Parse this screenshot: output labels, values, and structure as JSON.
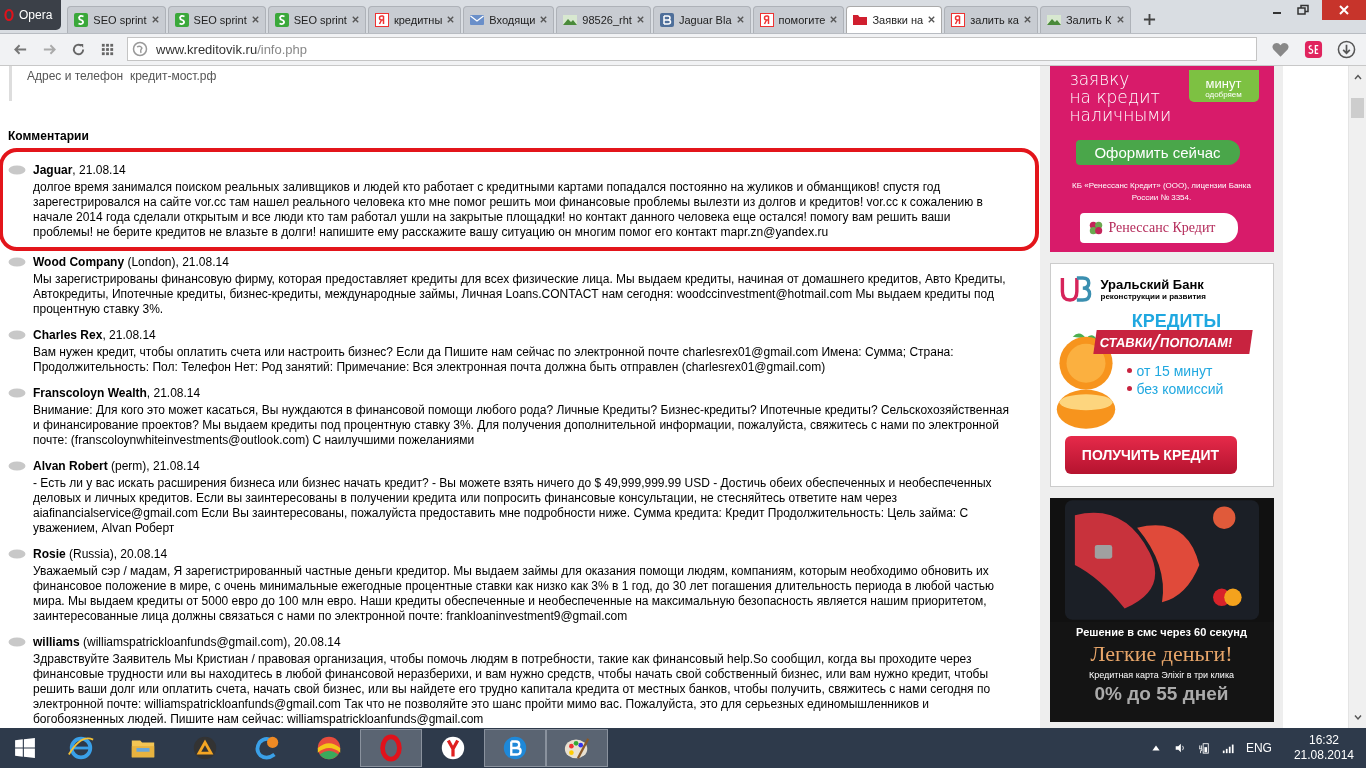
{
  "browser": {
    "menu_label": "Opera"
  },
  "tabs": [
    {
      "title": "SEO sprint",
      "kind": "seo",
      "selected": false
    },
    {
      "title": "SEO sprint",
      "kind": "seo",
      "selected": false
    },
    {
      "title": "SEO sprint",
      "kind": "seo",
      "selected": false
    },
    {
      "title": "кредитны",
      "kind": "yandex",
      "selected": false
    },
    {
      "title": "Входящи",
      "kind": "mail",
      "selected": false
    },
    {
      "title": "98526_rht",
      "selected": false
    },
    {
      "title": "Jaguar Bla",
      "kind": "vk",
      "selected": false
    },
    {
      "title": "помогите",
      "kind": "yandex",
      "selected": false
    },
    {
      "title": "Заявки на",
      "kind": "folder",
      "selected": true
    },
    {
      "title": "залить ка",
      "kind": "yandex",
      "selected": false
    },
    {
      "title": "Залить К",
      "selected": false
    }
  ],
  "address": {
    "host": "www.kreditovik.ru",
    "path": "/info.php"
  },
  "page": {
    "address_line": "Адрес и телефон  кредит-мост.рф",
    "comments_heading": "Комментарии"
  },
  "comments": [
    {
      "header": "**Jaguar**, 21.08.14",
      "highlighted": true,
      "text": "долгое время занимался поиском реальных заливщиков и людей кто работает с кредитными картами попадался постоянно на жуликов и обманщиков! спустя год зарегестрировался на сайте vor.cc там нашел реального человека кто мне помог решить мои финансовые проблемы вылезти из долгов и кредитов! vor.cc к сожалению в начале 2014 года сделали открытым и все люди кто там работал ушли на закрытые площадки! но контакт данного человека еще остался! помогу вам решить ваши проблемы! не берите кредитов не влазьте в долги! напишите ему расскажите вашу ситуацию он многим помог его контакт mapr.zn@yandex.ru"
    },
    {
      "header": "**Wood Company** (London), 21.08.14",
      "highlighted": false,
      "text": "Мы зарегистрированы финансовую фирму, которая предоставляет кредиты для всех физические лица. Мы выдаем кредиты, начиная от домашнего кредитов, Авто Кредиты, Автокредиты, Ипотечные кредиты, бизнес-кредиты, международные займы, Личная Loans.CONTACT нам сегодня: woodccinvestment@hotmail.com Мы выдаем кредиты под процентную ставку 3%."
    },
    {
      "header": "**Charles Rex**, 21.08.14",
      "highlighted": false,
      "text": "Вам нужен кредит, чтобы оплатить счета или настроить бизнес? Если да Пишите нам сейчас по электронной почте charlesrex01@gmail.com Имена: Сумма; Страна: Продолжительность: Пол: Телефон Нет: Род занятий: Примечание: Вся электронная почта должна быть отправлен (charlesrex01@gmail.com)"
    },
    {
      "header": "**Franscoloyn Wealth**, 21.08.14",
      "highlighted": false,
      "text": "Внимание: Для кого это может касаться, Вы нуждаются в финансовой помощи любого рода? Личные Кредиты? Бизнес-кредиты? Ипотечные кредиты? Сельскохозяйственная и финансирование проектов? Мы выдаем кредиты под процентную ставку 3%. Для получения дополнительной информации, пожалуйста, свяжитесь с нами по электронной почте: (franscoloynwhiteinvestments@outlook.com) С наилучшими пожеланиями"
    },
    {
      "header": "**Alvan Robert** (perm), 21.08.14",
      "highlighted": false,
      "text": "- Есть ли у вас искать расширения бизнеса или бизнес начать кредит? - Вы можете взять ничего до $ 49,999,999.99 USD - Достичь обеих обеспеченных и необеспеченных деловых и личных кредитов. Если вы заинтересованы в получении кредита или попросить финансовые консультации, не стесняйтесь ответите нам через aiafinancialservice@gmail.com Если Вы заинтересованы, пожалуйста предоставить мне подробности ниже. Сумма кредита: Кредит Продолжительность: Цель займа: С уважением, Alvan Роберт"
    },
    {
      "header": "**Rosie** (Russia), 20.08.14",
      "highlighted": false,
      "text": "Уважаемый сэр / мадам, Я зарегистрированный частные деньги кредитор. Мы выдаем займы для оказания помощи людям, компаниям, которым необходимо обновить их финансовое положение в мире, с очень минимальные ежегодные процентные ставки как низко как 3% в 1 год, до 30 лет погашения длительность периода в любой частью мира. Мы выдаем кредиты от 5000 евро до 100 млн евро. Наши кредиты обеспеченные и необеспеченные на максимальную безопасность является нашим приоритетом, заинтересованные лица должны связаться с нами по электронной почте: frankloaninvestment9@gmail.com"
    },
    {
      "header": "**williams** (williamspatrickloanfunds@gmail.com), 20.08.14",
      "highlighted": false,
      "text": "Здравствуйте Заявитель Мы Кристиан / правовая организация, чтобы помочь людям в потребности, такие как финансовый help.So сообщил, когда вы проходите через финансовые трудности или вы находитесь в любой финансовой неразберихи, и вам нужно средств, чтобы начать свой собственный бизнес, или вам нужно кредит, чтобы решить ваши долг или оплатить счета, начать свой бизнес, или вы найдете его трудно капитала кредита от местных банков, чтобы получить, свяжитесь с нами сегодня по электронной почте: williamspatrickloanfunds@gmail.com Так что не позволяйте это шанс пройти мимо вас. Пожалуйста, это для серьезных единомышленников и богобоязненных людей. Пишите нам сейчас: williamspatrickloanfunds@gmail.com"
    }
  ],
  "ads": [
    {
      "kind": "renaissance",
      "headline": [
        "заявку",
        "на кредит",
        "наличными"
      ],
      "badge": "минут",
      "badge_note": "одобряем",
      "button": "Оформить сейчас",
      "legal": "КБ «Ренессанс Кредит» (ООО), лицензии Банка России № 3354.",
      "logo": "Ренессанс Кредит"
    },
    {
      "kind": "ural",
      "bank": "Уральский Банк",
      "bank_sub": "реконструкции и развития",
      "title": "КРЕДИТЫ",
      "ribbon": [
        "СТАВКИ",
        "ПОПОЛАМ!"
      ],
      "bullets": [
        "от 15 минут",
        "без комиссий"
      ],
      "button": "ПОЛУЧИТЬ КРЕДИТ"
    },
    {
      "kind": "card",
      "line1": "Решение в смс через 60 секунд",
      "title": "Легкие деньги!",
      "line2": "Кредитная карта Элixir в три клика",
      "offer": "0% до 55 дней"
    }
  ],
  "taskbar": [
    {
      "kind": "ie",
      "active": false
    },
    {
      "kind": "explorer",
      "active": false
    },
    {
      "kind": "aimp",
      "active": false
    },
    {
      "kind": "swirl",
      "active": false
    },
    {
      "kind": "ball",
      "active": false
    },
    {
      "kind": "opera",
      "active": true
    },
    {
      "kind": "yandex",
      "active": false
    },
    {
      "kind": "b",
      "active": true
    },
    {
      "kind": "paint",
      "active": true
    }
  ],
  "tray": {
    "language": "ENG",
    "time": "16:32",
    "date": "21.08.2014"
  }
}
